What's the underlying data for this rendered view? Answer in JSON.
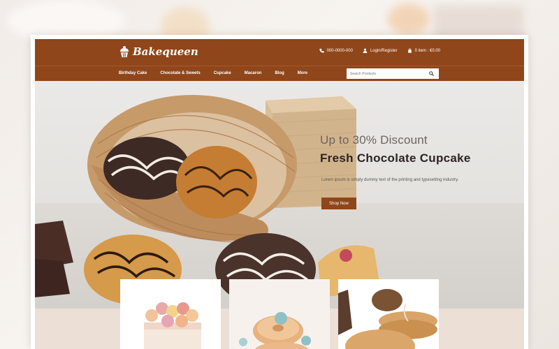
{
  "brand": {
    "name": "Bakequeen"
  },
  "topbar": {
    "phone": "000-0000-000",
    "login": "Login/Register",
    "cart": "0 item : €0.00"
  },
  "nav": {
    "items": [
      {
        "label": "Birthday Cake"
      },
      {
        "label": "Chocolate & Sweets"
      },
      {
        "label": "Cupcake"
      },
      {
        "label": "Macaron"
      },
      {
        "label": "Blog"
      },
      {
        "label": "More"
      }
    ],
    "search_placeholder": "Search Products"
  },
  "hero": {
    "discount": "Up to 30% Discount",
    "headline": "Fresh Chocolate Cupcake",
    "description": "Lorem ipsum is simply dummy text of the printing and typesetting industry.",
    "button": "Shop Now"
  },
  "colors": {
    "brand": "#8f461a",
    "hero_bg": "#e6e3e0",
    "strip_bg": "#ecdfd6"
  },
  "icons": {
    "logo": "cupcake-icon",
    "phone": "phone-icon",
    "user": "user-icon",
    "cart": "cart-icon",
    "search": "search-icon"
  }
}
